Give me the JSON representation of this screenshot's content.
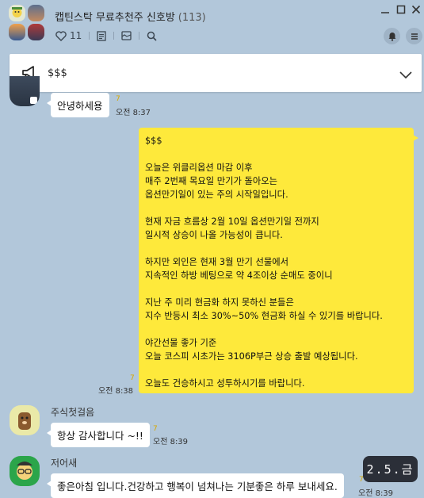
{
  "header": {
    "title": "캡틴스탁 무료추천주 신호방",
    "member_count": "(113)",
    "likes": "11"
  },
  "notice": {
    "text": "$$$"
  },
  "messages": {
    "m1": {
      "text": "안녕하세용",
      "unread": "7",
      "time": "오전 8:37"
    },
    "m2": {
      "lines": [
        "$$$",
        "",
        "오늘은 위클리옵션 마감 이후",
        "매주 2번째 목요일 만기가 돌아오는",
        "옵션만기일이 있는 주의 시작일입니다.",
        "",
        " 현재 자금 흐름상 2월 10일 옵션만기일 전까지",
        "일시적 상승이 나올 가능성이 큽니다.",
        "",
        "  하지만 외인은 현재 3월 만기 선물에서",
        "지속적인 하방 베팅으로 약 4조이상 순매도 중이니",
        "",
        " 지난 주 미리 현금화 하지 못하신 분들은",
        "지수 반등시 최소 30%~50% 현금화 하실 수 있기를 바랍니다.",
        "",
        "야간선물 좋가 기준",
        "오늘 코스피 시초가는 3106P부근 상승 출발 예상됩니다.",
        "",
        "오늘도 건승하시고 성투하시기를 바랍니다."
      ],
      "unread": "7",
      "time": "오전 8:38"
    },
    "m3": {
      "sender": "주식첫걸음",
      "text": "항상 감사합니다 ~!!",
      "unread": "7",
      "time": "오전 8:39"
    },
    "m4": {
      "sender": "저어새",
      "text": "좋은아침 입니다.건강하고 행복이 넘쳐나는 기분좋은 하루 보내세요.",
      "unread": "7",
      "time": "오전 8:39"
    }
  },
  "date_badge": "2.5.금",
  "colors": {
    "background": "#b2c7da",
    "my_bubble": "#fee93b",
    "other_bubble": "#ffffff",
    "unread_count": "#d6a800"
  },
  "icons": [
    "heart-icon",
    "notes-icon",
    "album-icon",
    "search-icon",
    "bell-icon",
    "menu-icon",
    "megaphone-icon",
    "chevron-down-icon",
    "minimize-icon",
    "maximize-icon",
    "close-icon"
  ]
}
